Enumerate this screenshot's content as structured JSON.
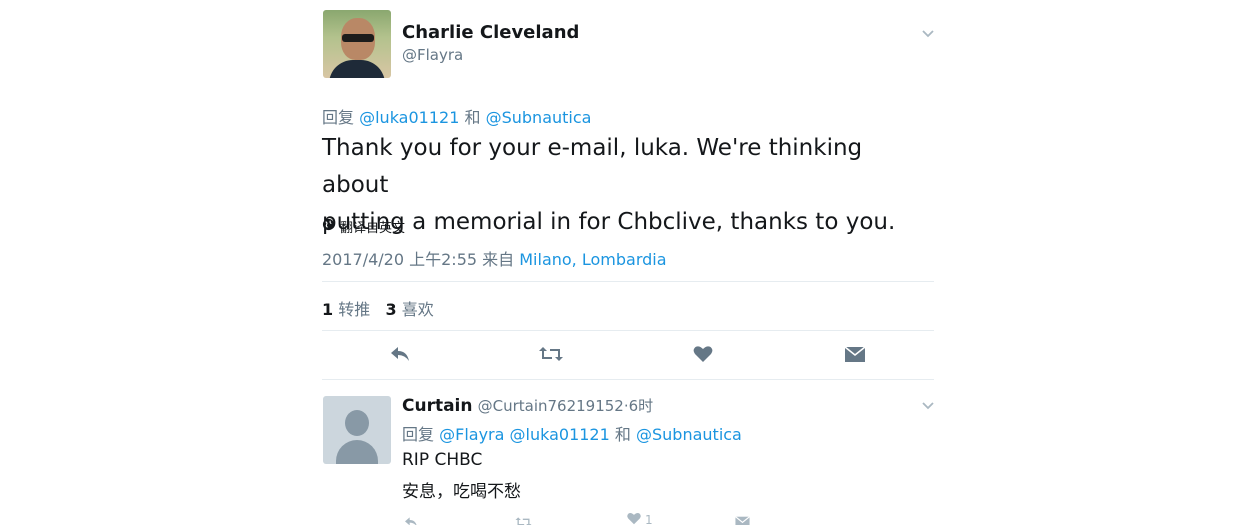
{
  "main_tweet": {
    "author_name": "Charlie Cleveland",
    "author_handle": "@Flayra",
    "reply_prefix": "回复",
    "reply_mention_1": "@luka01121",
    "reply_conjunction": "和",
    "reply_mention_2": "@Subnautica",
    "text_line_1": "Thank you for your e-mail, luka. We're thinking about",
    "text_line_2": "putting a memorial in for Chbclive, thanks to you.",
    "translate_label": "翻译自英文",
    "timestamp": "2017/4/20 上午2:55 来自",
    "location": "Milano, Lombardia",
    "retweet_count": "1",
    "retweet_label": "转推",
    "like_count": "3",
    "like_label": "喜欢"
  },
  "reply_tweet": {
    "author_name": "Curtain",
    "author_handle": "@Curtain76219152",
    "separator": "·",
    "time": "6时",
    "reply_prefix": "回复",
    "mention_1": "@Flayra",
    "mention_2": "@luka01121",
    "conjunction": "和",
    "mention_3": "@Subnautica",
    "text_line_1": "RIP CHBC",
    "text_line_2": "安息，吃喝不愁",
    "like_count": "1"
  },
  "icons": {
    "reply": "reply-icon",
    "retweet": "retweet-icon",
    "like": "heart-icon",
    "dm": "envelope-icon",
    "globe": "globe-icon",
    "chevron": "chevron-down-icon"
  },
  "colors": {
    "link": "#1b95e0",
    "muted": "#657786",
    "text": "#14171a"
  }
}
